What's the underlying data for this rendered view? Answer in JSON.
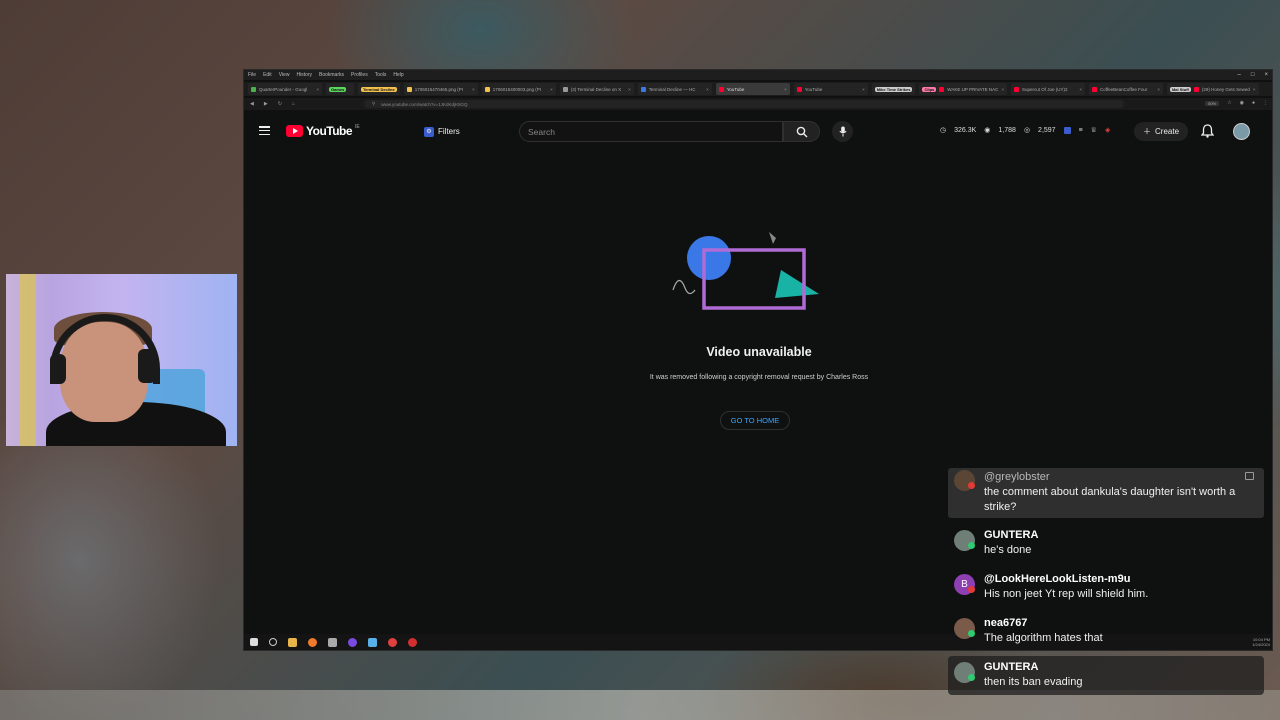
{
  "browser": {
    "menu": [
      "File",
      "Edit",
      "View",
      "History",
      "Bookmarks",
      "Profiles",
      "Tools",
      "Help"
    ],
    "tabs": [
      {
        "label": "QuarterPounder - Googl",
        "color": "#4caf50"
      },
      {
        "group": "Games",
        "group_color": "#5cd65c",
        "label": ""
      },
      {
        "group": "Terminal Decline",
        "group_color": "#f2c14e",
        "label": ""
      },
      {
        "label": "1706015470465.png (PI",
        "color": "#f2c14e"
      },
      {
        "label": "1706015400003.png (PI",
        "color": "#f2c14e"
      },
      {
        "label": "(3) Terminal Decline on X",
        "color": "#999999"
      },
      {
        "label": "Terminal Decline — HC",
        "color": "#3b78e7"
      },
      {
        "label": "YouTube",
        "color": "#ff0033",
        "active": true
      },
      {
        "label": "YouTube",
        "color": "#ff0033"
      },
      {
        "group": "Mike Time Strikes",
        "group_color": "#cccccc",
        "label": ""
      },
      {
        "group": "Clips",
        "group_color": "#ff7aa8",
        "label": "WAKE UP PRIVATE NAC",
        "color": "#ff0033"
      },
      {
        "label": "Supercut Of Joe (UY)2",
        "color": "#ff0033"
      },
      {
        "label": "CoffeeBeanCoffee Four",
        "color": "#ff0033"
      },
      {
        "group": "Mal Stuff",
        "group_color": "#cccccc",
        "label": "(29) Honey Gets Sewed",
        "color": "#ff0033"
      }
    ],
    "url": "www.youtube.com/watch?v=1JKdKdjK5GQ",
    "zoom": "50%",
    "window_controls": [
      "–",
      "□",
      "×"
    ]
  },
  "youtube": {
    "logo_text": "YouTube",
    "logo_sup": "IE",
    "filters_label": "Filters",
    "search_placeholder": "Search",
    "stats": [
      {
        "value": "326.3K",
        "icon": "clock-icon"
      },
      {
        "value": "1,788",
        "icon": "eye-icon"
      },
      {
        "value": "2,597",
        "icon": "eye-icon"
      }
    ],
    "create_label": "Create",
    "unavailable_title": "Video unavailable",
    "unavailable_desc": "It was removed following a copyright removal request by Charles Ross",
    "home_button": "GO TO HOME"
  },
  "taskbar": {
    "clock_line1": "10:04 PM",
    "clock_line2": "1/24/2024"
  },
  "chat": {
    "messages": [
      {
        "name": "@greylobster",
        "text": "the comment about dankula's daughter isn't worth a strike?",
        "avatar_color": "#5b4636",
        "badge_color": "#e53935"
      },
      {
        "name": "GUNTERA",
        "text": "he's done",
        "avatar_color": "#6f7f78",
        "badge_color": "#2ecc71"
      },
      {
        "name": "@LookHereLookListen-m9u",
        "text": "His non jeet Yt rep will shield him.",
        "avatar_letter": "B",
        "avatar_color": "#8e3fb2",
        "badge_color": "#e53935"
      },
      {
        "name": "nea6767",
        "text": "The algorithm hates that",
        "avatar_color": "#7a5a48",
        "badge_color": "#2ecc71"
      },
      {
        "name": "GUNTERA",
        "text": "then its ban evading",
        "avatar_color": "#6f7f78",
        "badge_color": "#2ecc71"
      }
    ]
  },
  "colors": {
    "yt_red": "#ff0033",
    "link_blue": "#3ea6ff",
    "illus_blue": "#3b78e7",
    "illus_purple": "#b06bd6",
    "illus_teal": "#19b3a6"
  }
}
